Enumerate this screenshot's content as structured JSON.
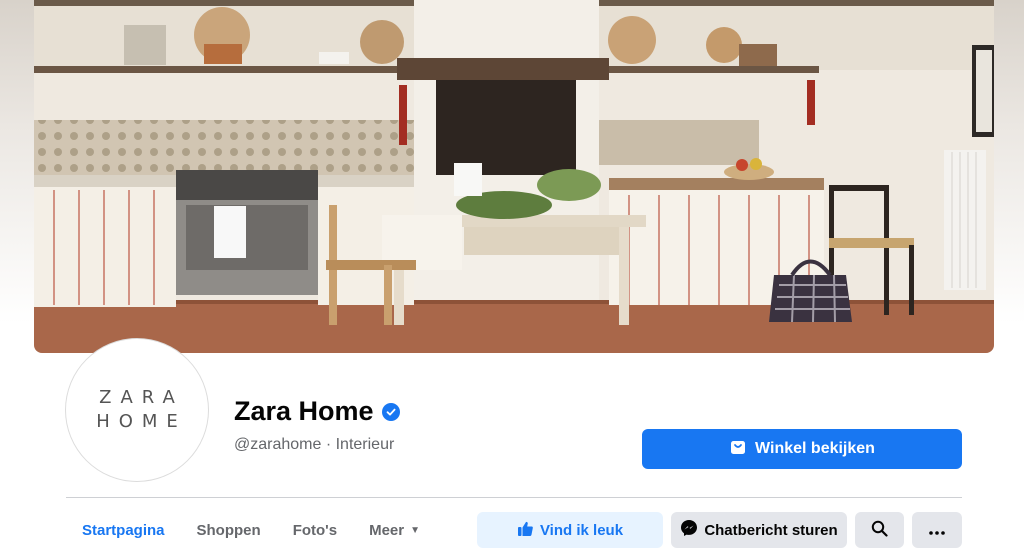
{
  "page": {
    "name": "Zara Home",
    "handle": "@zarahome",
    "separator": " · ",
    "category": "Interieur",
    "logo_line1": "ZARA",
    "logo_line2": "HOME"
  },
  "actions": {
    "shop_label": "Winkel bekijken",
    "like_label": "Vind ik leuk",
    "chat_label": "Chatbericht sturen"
  },
  "tabs": [
    {
      "label": "Startpagina",
      "active": true
    },
    {
      "label": "Shoppen"
    },
    {
      "label": "Foto's"
    },
    {
      "label": "Meer"
    }
  ],
  "icons": {
    "verified": "verified-badge-icon",
    "shop": "shop-icon",
    "like": "thumbs-up-icon",
    "chat": "messenger-icon",
    "search": "search-icon",
    "more": "more-icon",
    "dropdown": "caret-down-icon"
  },
  "colors": {
    "accent": "#1877f2",
    "like_bg": "#e7f3ff",
    "secondary_bg": "#e4e6eb",
    "text_primary": "#050505",
    "text_secondary": "#65676b"
  }
}
